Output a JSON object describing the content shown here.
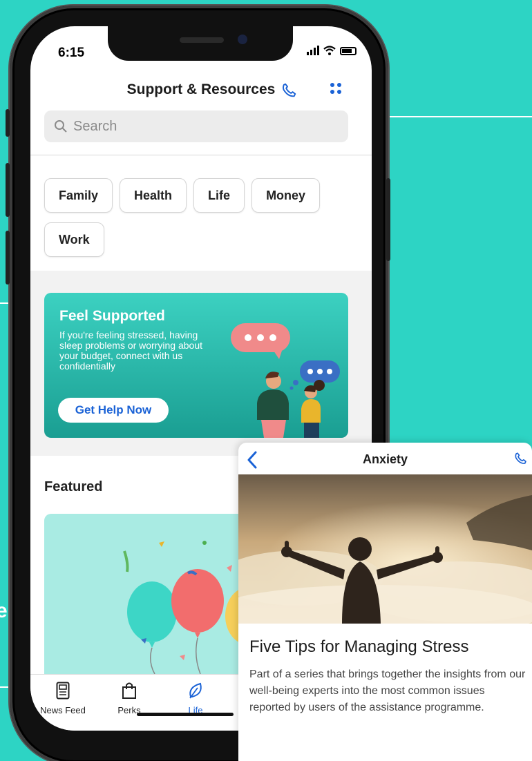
{
  "status": {
    "time": "6:15"
  },
  "header": {
    "title": "Support & Resources"
  },
  "search": {
    "placeholder": "Search"
  },
  "categories": [
    "Family",
    "Health",
    "Life",
    "Money",
    "Work"
  ],
  "banner": {
    "title": "Feel Supported",
    "text": "If you're feeling stressed, having sleep problems or worrying about your budget, connect with us confidentially",
    "button_label": "Get Help Now"
  },
  "featured": {
    "label": "Featured"
  },
  "tabs": [
    {
      "label": "News Feed",
      "icon": "news-feed-icon"
    },
    {
      "label": "Perks",
      "icon": "shopping-bag-icon"
    },
    {
      "label": "Life",
      "icon": "leaf-icon",
      "active": true
    }
  ],
  "article": {
    "title": "Anxiety",
    "heading": "Five Tips for Managing Stress",
    "body": "Part of a series that brings together the insights from our well-being experts into the most common issues reported by users of the assistance programme."
  },
  "side_text": "e",
  "colors": {
    "background": "#2dd4c4",
    "accent": "#1a62d6",
    "banner": "#23b3a5"
  }
}
